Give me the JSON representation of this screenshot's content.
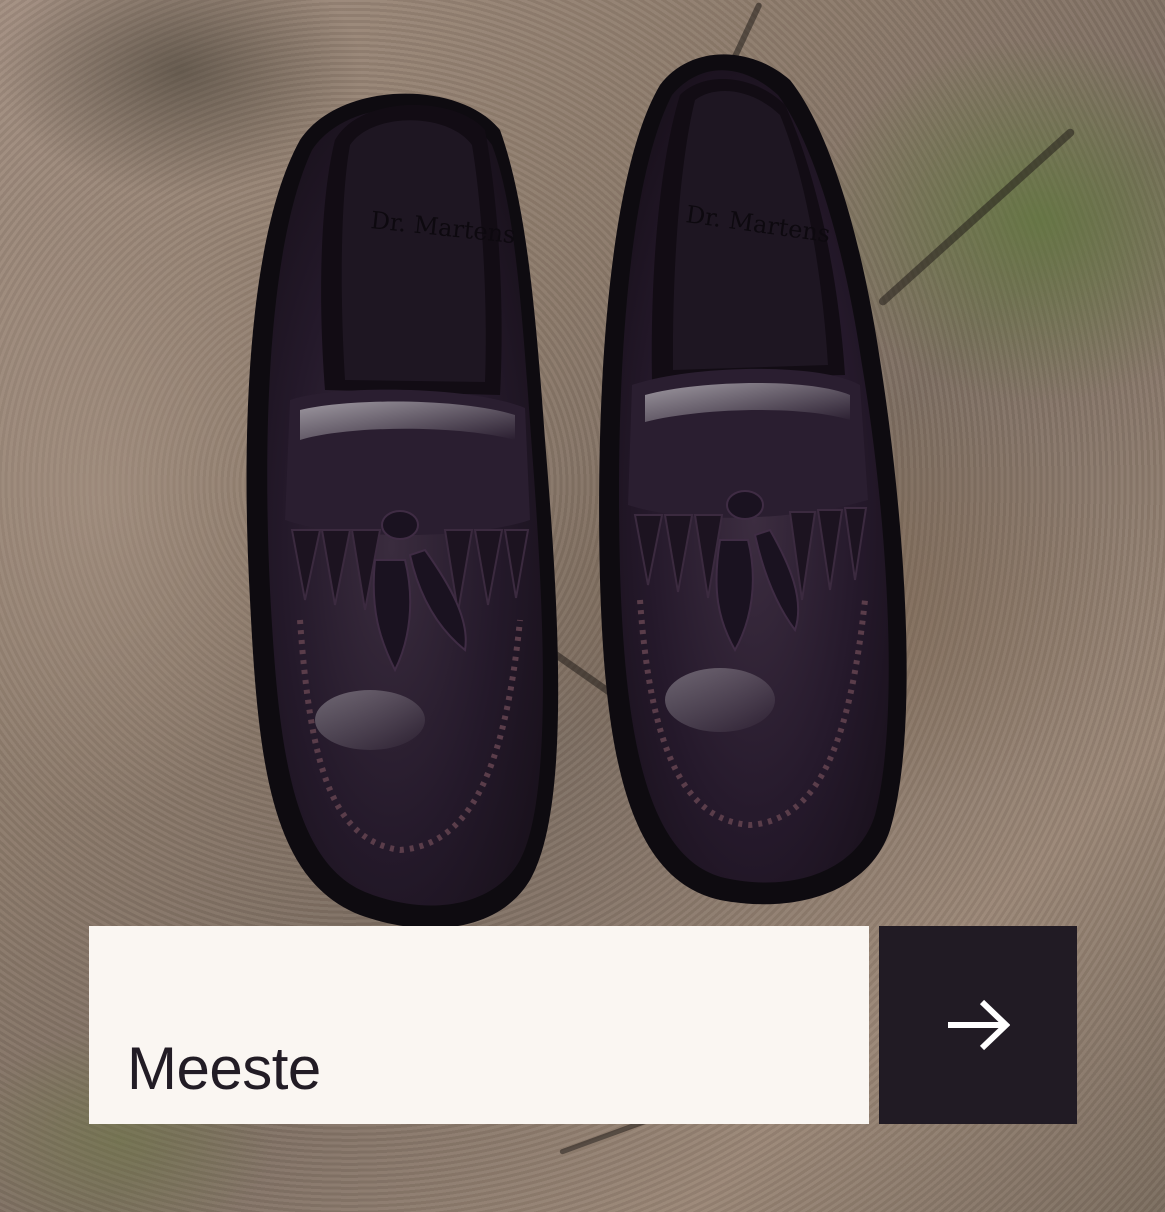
{
  "promo": {
    "label": "Meeste",
    "cta_icon": "arrow-right-icon"
  },
  "image": {
    "subject": "shoes-photo",
    "brand_mark": "Dr. Martens"
  },
  "colors": {
    "label_background": "#faf6f2",
    "button_background": "#211b24",
    "text": "#221c25",
    "arrow": "#ffffff",
    "leather": "#2a1c26",
    "stone": "#8c7a6a"
  }
}
